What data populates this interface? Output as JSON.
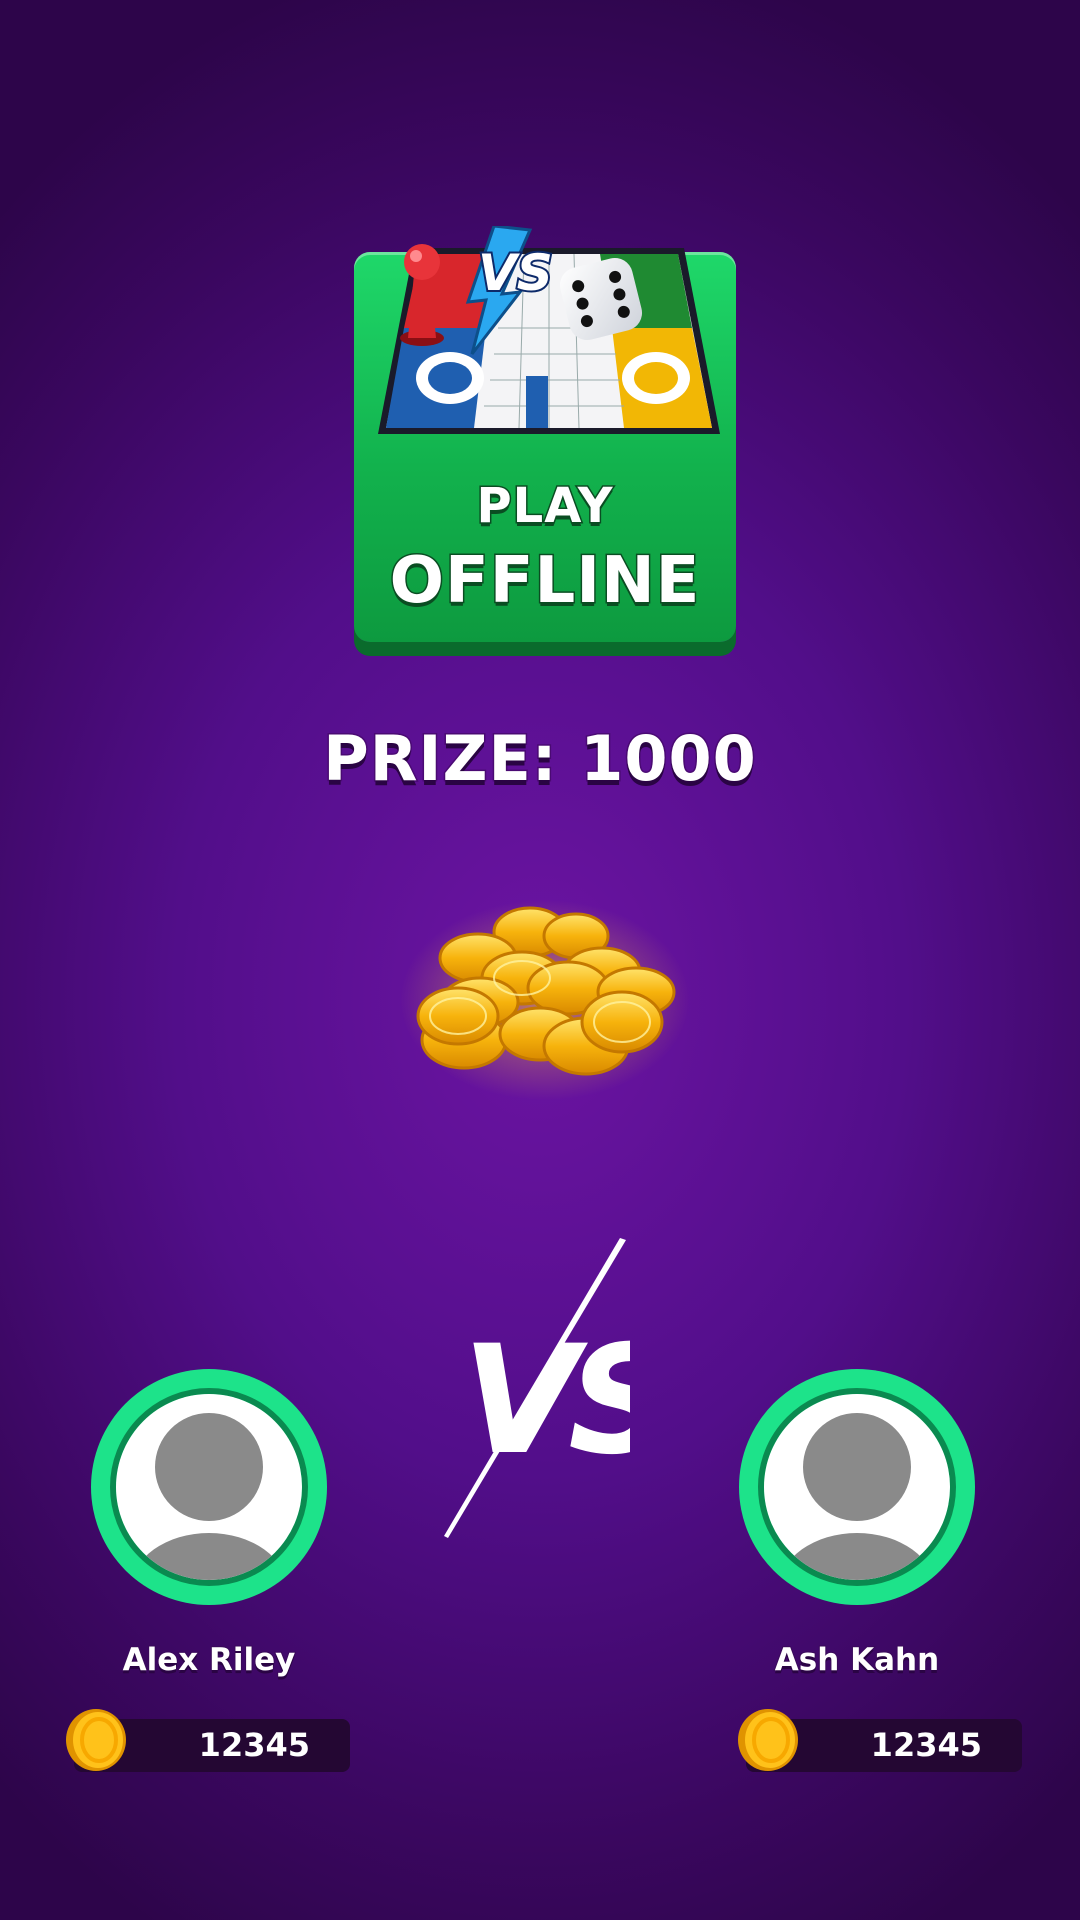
{
  "mode_card": {
    "line1": "PLAY",
    "line2": "OFFLINE",
    "badge_text": "VS"
  },
  "prize": {
    "text": "PRIZE: 1000"
  },
  "vs_text": "VS",
  "players": [
    {
      "name": "Alex Riley",
      "balance": "12345"
    },
    {
      "name": "Ash Kahn",
      "balance": "12345"
    }
  ],
  "colors": {
    "background": "#520e8a",
    "card_green": "#12b24d",
    "avatar_ring": "#1de38a",
    "coin_gold": "#f5b90f"
  }
}
